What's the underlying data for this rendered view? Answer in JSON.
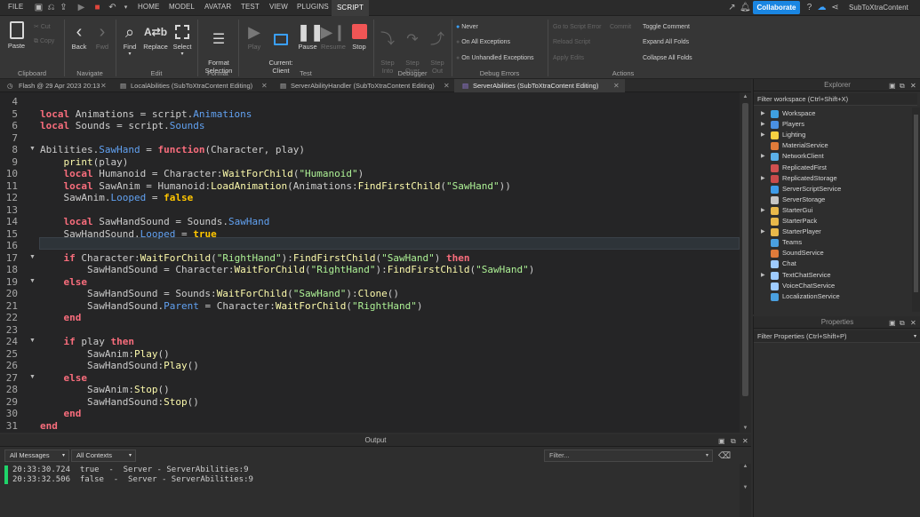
{
  "menubar": {
    "file": "FILE",
    "tabs": [
      "HOME",
      "MODEL",
      "AVATAR",
      "TEST",
      "VIEW",
      "PLUGINS",
      "SCRIPT"
    ],
    "active_tab": "SCRIPT",
    "collaborate": "Collaborate",
    "username": "SubToXtraContent"
  },
  "ribbon": {
    "clipboard": {
      "paste": "Paste",
      "cut": "Cut",
      "copy": "Copy",
      "label": "Clipboard"
    },
    "navigate": {
      "back": "Back",
      "fwd": "Fwd",
      "label": "Navigate"
    },
    "edit": {
      "find": "Find",
      "replace": "Replace",
      "select": "Select",
      "label": "Edit"
    },
    "format": {
      "format_selection": "Format\nSelection",
      "label": "Format"
    },
    "test": {
      "play": "Play",
      "current": "Current:\nClient",
      "pause": "Pause",
      "resume": "Resume",
      "stop": "Stop",
      "label": "Test"
    },
    "debugger": {
      "step_into": "Step\nInto",
      "step_over": "Step\nOver",
      "step_out": "Step\nOut",
      "label": "Debugger"
    },
    "debug_errors": {
      "never": "Never",
      "on_all": "On All Exceptions",
      "on_unhandled": "On Unhandled Exceptions",
      "label": "Debug Errors"
    },
    "actions": {
      "go_to_error": "Go to Script Error",
      "commit": "Commit",
      "reload": "Reload Script",
      "apply": "Apply Edits",
      "toggle_comment": "Toggle Comment",
      "expand_all": "Expand All Folds",
      "collapse_all": "Collapse All Folds",
      "label": "Actions"
    }
  },
  "doc_tabs": [
    {
      "label": "Flash @ 29 Apr 2023 20:13"
    },
    {
      "label": "LocalAbilities (SubToXtraContent Editing)"
    },
    {
      "label": "ServerAbilityHandler (SubToXtraContent Editing)"
    },
    {
      "label": "ServerAbilities (SubToXtraContent Editing)"
    }
  ],
  "code": {
    "line_numbers": [
      "4",
      "5",
      "6",
      "7",
      "8",
      "9",
      "10",
      "11",
      "12",
      "13",
      "14",
      "15",
      "16",
      "17",
      "18",
      "19",
      "20",
      "21",
      "22",
      "23",
      "24",
      "25",
      "26",
      "27",
      "28",
      "29",
      "30",
      "31"
    ],
    "lines": [
      "",
      "local Animations = script.Animations",
      "local Sounds = script.Sounds",
      "",
      "Abilities.SawHand = function(Character, play)",
      "    print(play)",
      "    local Humanoid = Character:WaitForChild(\"Humanoid\")",
      "    local SawAnim = Humanoid:LoadAnimation(Animations:FindFirstChild(\"SawHand\"))",
      "    SawAnim.Looped = false",
      "",
      "    local SawHandSound = Sounds.SawHand",
      "    SawHandSound.Looped = true",
      "",
      "    if Character:WaitForChild(\"RightHand\"):FindFirstChild(\"SawHand\") then",
      "        SawHandSound = Character:WaitForChild(\"RightHand\"):FindFirstChild(\"SawHand\")",
      "    else",
      "        SawHandSound = Sounds:WaitForChild(\"SawHand\"):Clone()",
      "        SawHandSound.Parent = Character:WaitForChild(\"RightHand\")",
      "    end",
      "",
      "    if play then",
      "        SawAnim:Play()",
      "        SawHandSound:Play()",
      "    else",
      "        SawAnim:Stop()",
      "        SawHandSound:Stop()",
      "    end",
      "end"
    ],
    "current_line": "16"
  },
  "output": {
    "title": "Output",
    "filter_messages": "All Messages",
    "filter_contexts": "All Contexts",
    "filter_placeholder": "Filter...",
    "lines": [
      "20:33:30.724  true  -  Server - ServerAbilities:9",
      "20:33:32.506  false  -  Server - ServerAbilities:9"
    ]
  },
  "explorer": {
    "title": "Explorer",
    "filter": "Filter workspace (Ctrl+Shift+X)",
    "items": [
      {
        "label": "Workspace",
        "expandable": true,
        "color": "#3fa0e0"
      },
      {
        "label": "Players",
        "expandable": true,
        "color": "#4a90e2"
      },
      {
        "label": "Lighting",
        "expandable": true,
        "color": "#f5d142"
      },
      {
        "label": "MaterialService",
        "expandable": false,
        "color": "#e07b3a"
      },
      {
        "label": "NetworkClient",
        "expandable": true,
        "color": "#5bb0e8"
      },
      {
        "label": "ReplicatedFirst",
        "expandable": false,
        "color": "#d05050"
      },
      {
        "label": "ReplicatedStorage",
        "expandable": true,
        "color": "#c94b4b"
      },
      {
        "label": "ServerScriptService",
        "expandable": false,
        "color": "#3d9be9"
      },
      {
        "label": "ServerStorage",
        "expandable": false,
        "color": "#c5c5c5"
      },
      {
        "label": "StarterGui",
        "expandable": true,
        "color": "#e8b84a"
      },
      {
        "label": "StarterPack",
        "expandable": false,
        "color": "#e8b84a"
      },
      {
        "label": "StarterPlayer",
        "expandable": true,
        "color": "#e8b84a"
      },
      {
        "label": "Teams",
        "expandable": false,
        "color": "#4aa0e0"
      },
      {
        "label": "SoundService",
        "expandable": false,
        "color": "#e07b3a"
      },
      {
        "label": "Chat",
        "expandable": false,
        "color": "#9ecbff"
      },
      {
        "label": "TextChatService",
        "expandable": true,
        "color": "#9ecbff"
      },
      {
        "label": "VoiceChatService",
        "expandable": false,
        "color": "#9ecbff"
      },
      {
        "label": "LocalizationService",
        "expandable": false,
        "color": "#4aa0e0"
      }
    ]
  },
  "properties": {
    "title": "Properties",
    "filter": "Filter Properties (Ctrl+Shift+P)"
  }
}
